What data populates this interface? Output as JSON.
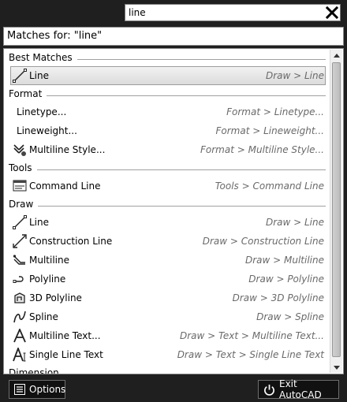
{
  "search": {
    "value": "line"
  },
  "matches_header": "Matches for: \"line\"",
  "sections": [
    {
      "title": "Best Matches"
    },
    {
      "title": "Format"
    },
    {
      "title": "Tools"
    },
    {
      "title": "Draw"
    },
    {
      "title": "Dimension"
    }
  ],
  "best": [
    {
      "name": "Line",
      "path": "Draw > Line",
      "icon": "line-icon"
    }
  ],
  "format": [
    {
      "name": "Linetype...",
      "path": "Format > Linetype..."
    },
    {
      "name": "Lineweight...",
      "path": "Format > Lineweight..."
    },
    {
      "name": "Multiline Style...",
      "path": "Format > Multiline Style...",
      "icon": "multiline-style-icon"
    }
  ],
  "tools": [
    {
      "name": "Command Line",
      "path": "Tools > Command Line",
      "icon": "command-line-icon"
    }
  ],
  "draw": [
    {
      "name": "Line",
      "path": "Draw > Line",
      "icon": "line-icon"
    },
    {
      "name": "Construction Line",
      "path": "Draw > Construction Line",
      "icon": "construction-line-icon"
    },
    {
      "name": "Multiline",
      "path": "Draw > Multiline",
      "icon": "multiline-icon"
    },
    {
      "name": "Polyline",
      "path": "Draw > Polyline",
      "icon": "polyline-icon"
    },
    {
      "name": "3D Polyline",
      "path": "Draw > 3D Polyline",
      "icon": "3d-polyline-icon"
    },
    {
      "name": "Spline",
      "path": "Draw > Spline",
      "icon": "spline-icon"
    },
    {
      "name": "Multiline Text...",
      "path": "Draw > Text > Multiline Text...",
      "icon": "multiline-text-icon"
    },
    {
      "name": "Single Line Text",
      "path": "Draw > Text > Single Line Text",
      "icon": "single-line-text-icon"
    }
  ],
  "footer": {
    "options_label": "Options",
    "exit_label": "Exit AutoCAD"
  }
}
